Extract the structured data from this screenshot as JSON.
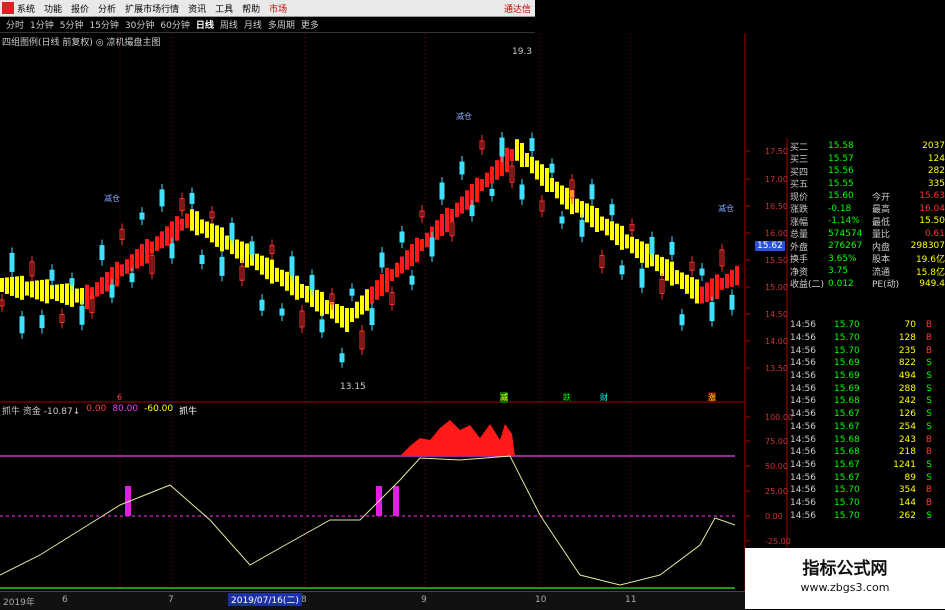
{
  "menu": {
    "items": [
      "系统",
      "功能",
      "报价",
      "分析",
      "扩展市场行情",
      "资讯",
      "工具",
      "帮助",
      "市场"
    ],
    "right": "通达信"
  },
  "periods": {
    "items": [
      "分时",
      "1分钟",
      "5分钟",
      "15分钟",
      "30分钟",
      "60分钟",
      "日线",
      "周线",
      "月线",
      "多周期",
      "更多"
    ],
    "active": "日线"
  },
  "chart_title": "四组图例(日线 前复权) ◎ 凉机撮盘主图",
  "annotations": {
    "high": "19.3",
    "low": "13.15",
    "jiancang": "减仓"
  },
  "price_axis": [
    "17.50",
    "17.00",
    "16.50",
    "16.00",
    "15.50",
    "15.00",
    "14.50",
    "14.00",
    "13.50"
  ],
  "current_price": "15.62",
  "indicator": {
    "name": "抓牛",
    "title": "抓牛  资金 -10.87↓",
    "v1": "0.00",
    "v2": "80.00",
    "v3": "-60.00",
    "name2": "抓牛",
    "axis": [
      "100.00",
      "75.00",
      "50.00",
      "25.00",
      "0.00",
      "-25.00"
    ]
  },
  "markers": {
    "jian": "减",
    "die": "跌",
    "cai": "财",
    "yan": "涨",
    "s6": "6"
  },
  "quote": [
    {
      "l": "买二",
      "v": "15.58",
      "l2": "",
      "v2": "2037"
    },
    {
      "l": "买三",
      "v": "15.57",
      "l2": "",
      "v2": "124"
    },
    {
      "l": "买四",
      "v": "15.56",
      "l2": "",
      "v2": "282"
    },
    {
      "l": "买五",
      "v": "15.55",
      "l2": "",
      "v2": "335"
    },
    {
      "l": "现价",
      "v": "15.60",
      "l2": "今开",
      "v2": "15.63"
    },
    {
      "l": "涨跌",
      "v": "-0.18",
      "l2": "最高",
      "v2": "16.04"
    },
    {
      "l": "涨幅",
      "v": "-1.14%",
      "l2": "最低",
      "v2": "15.50"
    },
    {
      "l": "总量",
      "v": "574574",
      "l2": "量比",
      "v2": "0.61"
    },
    {
      "l": "外盘",
      "v": "276267",
      "l2": "内盘",
      "v2": "298307"
    },
    {
      "l": "换手",
      "v": "3.65%",
      "l2": "股本",
      "v2": "19.6亿"
    },
    {
      "l": "净资",
      "v": "3.75",
      "l2": "流通",
      "v2": "15.8亿"
    },
    {
      "l": "收益(二)",
      "v": "0.012",
      "l2": "PE(动)",
      "v2": "949.4"
    }
  ],
  "trades": [
    {
      "t": "14:56",
      "p": "15.70",
      "q": "70",
      "s": "B"
    },
    {
      "t": "14:56",
      "p": "15.70",
      "q": "128",
      "s": "B"
    },
    {
      "t": "14:56",
      "p": "15.70",
      "q": "235",
      "s": "B"
    },
    {
      "t": "14:56",
      "p": "15.69",
      "q": "822",
      "s": "S"
    },
    {
      "t": "14:56",
      "p": "15.69",
      "q": "494",
      "s": "S"
    },
    {
      "t": "14:56",
      "p": "15.69",
      "q": "288",
      "s": "S"
    },
    {
      "t": "14:56",
      "p": "15.68",
      "q": "242",
      "s": "S"
    },
    {
      "t": "14:56",
      "p": "15.67",
      "q": "126",
      "s": "S"
    },
    {
      "t": "14:56",
      "p": "15.67",
      "q": "254",
      "s": "S"
    },
    {
      "t": "14:56",
      "p": "15.68",
      "q": "243",
      "s": "B"
    },
    {
      "t": "14:56",
      "p": "15.68",
      "q": "218",
      "s": "B"
    },
    {
      "t": "14:56",
      "p": "15.67",
      "q": "1241",
      "s": "S"
    },
    {
      "t": "14:56",
      "p": "15.67",
      "q": "89",
      "s": "S"
    },
    {
      "t": "14:56",
      "p": "15.70",
      "q": "354",
      "s": "B"
    },
    {
      "t": "14:56",
      "p": "15.70",
      "q": "144",
      "s": "B"
    },
    {
      "t": "14:56",
      "p": "15.70",
      "q": "262",
      "s": "S"
    }
  ],
  "bottom": {
    "year": "2019年",
    "m6": "6",
    "m7": "7",
    "date": "2019/07/16(二)",
    "m8": "8",
    "m9": "9",
    "m10": "10",
    "m11": "11"
  },
  "watermark": {
    "line1": "指标公式网",
    "line2": "www.zbgs3.com"
  },
  "colors": {
    "up": "#ff2020",
    "down": "#40e0ff",
    "band_up": "#ff1a1a",
    "band_down": "#ffff00",
    "ma": "#e6e6a0"
  }
}
